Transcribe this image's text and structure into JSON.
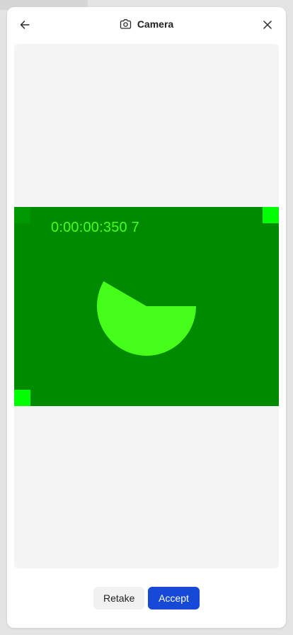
{
  "header": {
    "title": "Camera",
    "back_icon": "arrow-left-icon",
    "title_icon": "camera-icon",
    "close_icon": "close-icon"
  },
  "preview": {
    "timecode": "0:00:00:350 7",
    "colors": {
      "background": "#008a00",
      "pie": "#45ff1a",
      "corner_bright": "#00ff00"
    }
  },
  "actions": {
    "retake_label": "Retake",
    "accept_label": "Accept"
  },
  "colors": {
    "accent": "#1549d6",
    "modal_bg": "#ffffff",
    "viewer_bg": "#f4f4f4"
  }
}
